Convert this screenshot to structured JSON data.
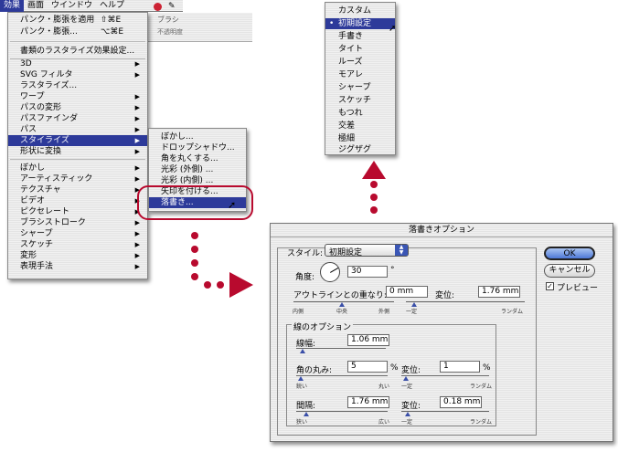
{
  "menubar": {
    "items": [
      "効果",
      "画面",
      "ウインドウ",
      "ヘルプ"
    ],
    "active_index": 0
  },
  "bg_strip": {
    "label": "ブラシ",
    "sub": "不透明度"
  },
  "effect_menu": {
    "top_items": [
      {
        "label": "パンク・膨張を適用",
        "shortcut": "⇧⌘E"
      },
      {
        "label": "パンク・膨張...",
        "shortcut": "⌥⌘E"
      }
    ],
    "doc_settings": "書類のラスタライズ効果設定...",
    "vector_items": [
      {
        "label": "3D",
        "sub": true
      },
      {
        "label": "SVG フィルタ",
        "sub": true
      },
      {
        "label": "ラスタライズ...",
        "sub": false
      },
      {
        "label": "ワープ",
        "sub": true
      },
      {
        "label": "パスの変形",
        "sub": true
      },
      {
        "label": "パスファインダ",
        "sub": true
      },
      {
        "label": "パス",
        "sub": true
      },
      {
        "label": "スタイライズ",
        "sub": true
      },
      {
        "label": "形状に変換",
        "sub": true
      }
    ],
    "raster_items": [
      {
        "label": "ぼかし",
        "sub": true
      },
      {
        "label": "アーティスティック",
        "sub": true
      },
      {
        "label": "テクスチャ",
        "sub": true
      },
      {
        "label": "ビデオ",
        "sub": true
      },
      {
        "label": "ピクセレート",
        "sub": true
      },
      {
        "label": "ブラシストローク",
        "sub": true
      },
      {
        "label": "シャープ",
        "sub": true
      },
      {
        "label": "スケッチ",
        "sub": true
      },
      {
        "label": "変形",
        "sub": true
      },
      {
        "label": "表現手法",
        "sub": true
      }
    ],
    "highlighted": "スタイライズ"
  },
  "stylize_submenu": {
    "items": [
      "ぼかし...",
      "ドロップシャドウ...",
      "角を丸くする...",
      "光彩 (外側) ...",
      "光彩 (内側) ...",
      "矢印を付ける...",
      "落書き..."
    ],
    "highlighted": "落書き..."
  },
  "style_popup": {
    "items": [
      "カスタム",
      "初期設定",
      "手書き",
      "タイト",
      "ルーズ",
      "モアレ",
      "シャープ",
      "スケッチ",
      "もつれ",
      "交差",
      "極細",
      "ジグザグ"
    ],
    "highlighted": "初期設定",
    "checkmark": "•"
  },
  "dialog": {
    "title": "落書きオプション",
    "style_label": "スタイル:",
    "style_value": "初期設定",
    "angle_label": "角度:",
    "angle_value": "30",
    "angle_unit": "°",
    "overlap_label": "アウトラインとの重なり:",
    "overlap_value": "0 mm",
    "overlap_var_label": "変位:",
    "overlap_var_value": "1.76 mm",
    "overlap_scale": [
      "内側",
      "中央",
      "外側"
    ],
    "overlap_var_scale": [
      "一定",
      "ランダム"
    ],
    "line_group_label": "線のオプション",
    "width_label": "線幅:",
    "width_value": "1.06 mm",
    "curve_label": "角の丸み:",
    "curve_value": "5",
    "curve_unit": "%",
    "curve_var_label": "変位:",
    "curve_var_value": "1",
    "curve_var_unit": "%",
    "curve_scale": [
      "鋭い",
      "丸い"
    ],
    "curve_var_scale": [
      "一定",
      "ランダム"
    ],
    "spacing_label": "間隔:",
    "spacing_value": "1.76 mm",
    "spacing_var_label": "変位:",
    "spacing_var_value": "0.18 mm",
    "spacing_scale": [
      "狭い",
      "広い"
    ],
    "spacing_var_scale": [
      "一定",
      "ランダム"
    ],
    "ok_label": "OK",
    "cancel_label": "キャンセル",
    "preview_label": "プレビュー",
    "preview_checked": true
  },
  "colors": {
    "highlight": "#2d3a9a",
    "callout": "#b80a2e"
  }
}
